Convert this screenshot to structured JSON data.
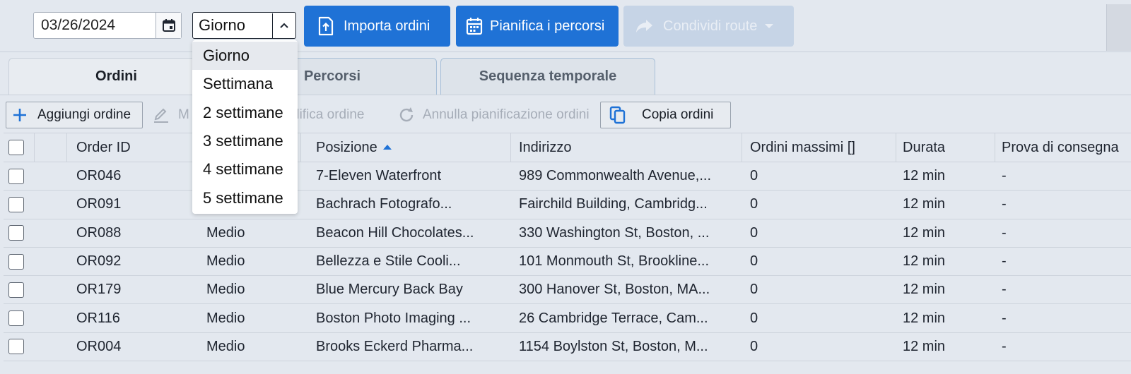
{
  "toolbar": {
    "date_value": "03/26/2024",
    "period_value": "Giorno",
    "import_label": "Importa ordini",
    "plan_label": "Pianifica i percorsi",
    "share_label": "Condividi route"
  },
  "period_options": [
    "Giorno",
    "Settimana",
    "2 settimane",
    "3 settimane",
    "4 settimane",
    "5 settimane"
  ],
  "tabs": [
    {
      "label": "Ordini",
      "active": true
    },
    {
      "label": "Percorsi",
      "active": false
    },
    {
      "label": "Sequenza temporale",
      "active": false
    }
  ],
  "actions": {
    "add_label": "Aggiungi ordine",
    "edit_partial": "M",
    "modify_partial": "difica ordine",
    "unplan_label": "Annulla pianificazione ordini",
    "copy_label": "Copia ordini"
  },
  "table": {
    "headers": {
      "order_id": "Order ID",
      "position": "Posizione",
      "address": "Indirizzo",
      "max_orders": "Ordini massimi []",
      "duration": "Durata",
      "proof": "Prova di consegna"
    },
    "rows": [
      {
        "id": "OR046",
        "priority": "",
        "position": "7-Eleven Waterfront",
        "address": "989 Commonwealth Avenue,...",
        "max": "0",
        "duration": "12 min",
        "proof": "-"
      },
      {
        "id": "OR091",
        "priority": "",
        "position": "Bachrach Fotografo...",
        "address": "Fairchild Building, Cambridg...",
        "max": "0",
        "duration": "12 min",
        "proof": "-"
      },
      {
        "id": "OR088",
        "priority": "Medio",
        "position": "Beacon Hill Chocolates...",
        "address": "330 Washington St, Boston, ...",
        "max": "0",
        "duration": "12 min",
        "proof": "-"
      },
      {
        "id": "OR092",
        "priority": "Medio",
        "position": "Bellezza e Stile Cooli...",
        "address": "101 Monmouth St, Brookline...",
        "max": "0",
        "duration": "12 min",
        "proof": "-"
      },
      {
        "id": "OR179",
        "priority": "Medio",
        "position": "Blue Mercury Back Bay",
        "address": "300 Hanover St, Boston, MA...",
        "max": "0",
        "duration": "12 min",
        "proof": "-"
      },
      {
        "id": "OR116",
        "priority": "Medio",
        "position": "Boston Photo Imaging ...",
        "address": "26 Cambridge Terrace, Cam...",
        "max": "0",
        "duration": "12 min",
        "proof": "-"
      },
      {
        "id": "OR004",
        "priority": "Medio",
        "position": "Brooks Eckerd Pharma...",
        "address": "1154 Boylston St, Boston, M...",
        "max": "0",
        "duration": "12 min",
        "proof": "-"
      }
    ]
  },
  "colors": {
    "primary": "#1f72d6",
    "disabled": "#c6d4e6",
    "background": "#e3e8ef"
  }
}
